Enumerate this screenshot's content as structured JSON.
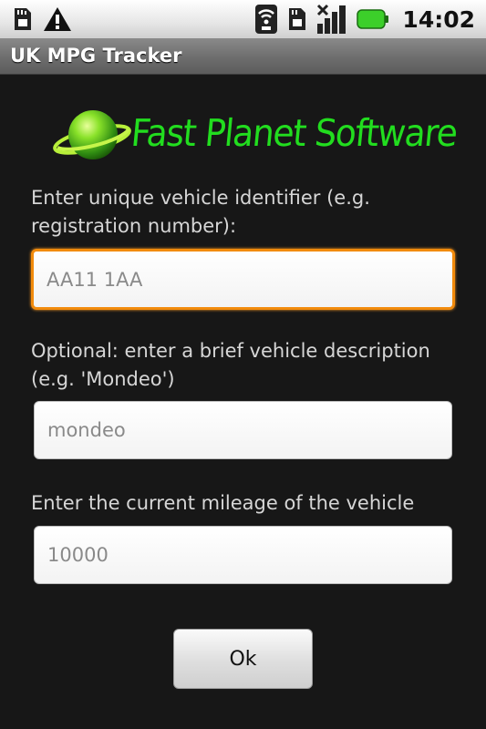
{
  "status_bar": {
    "time": "14:02",
    "icons": [
      "sd-card-icon",
      "warning-icon",
      "wifi-icon",
      "sim-card-icon",
      "signal-icon",
      "battery-icon"
    ]
  },
  "app": {
    "title": "UK MPG Tracker"
  },
  "logo": {
    "text": "Fast Planet Software"
  },
  "form": {
    "identifier_label": "Enter unique vehicle identifier (e.g. registration number):",
    "identifier_placeholder": "AA11 1AA",
    "identifier_value": "",
    "description_label": "Optional: enter a brief vehicle description (e.g. 'Mondeo')",
    "description_placeholder": "mondeo",
    "description_value": "",
    "mileage_label": "Enter the current mileage of the vehicle",
    "mileage_placeholder": "10000",
    "mileage_value": "",
    "ok_label": "Ok"
  },
  "colors": {
    "background": "#171717",
    "focus_border": "#f28b0c",
    "logo_green": "#22dd1f"
  }
}
